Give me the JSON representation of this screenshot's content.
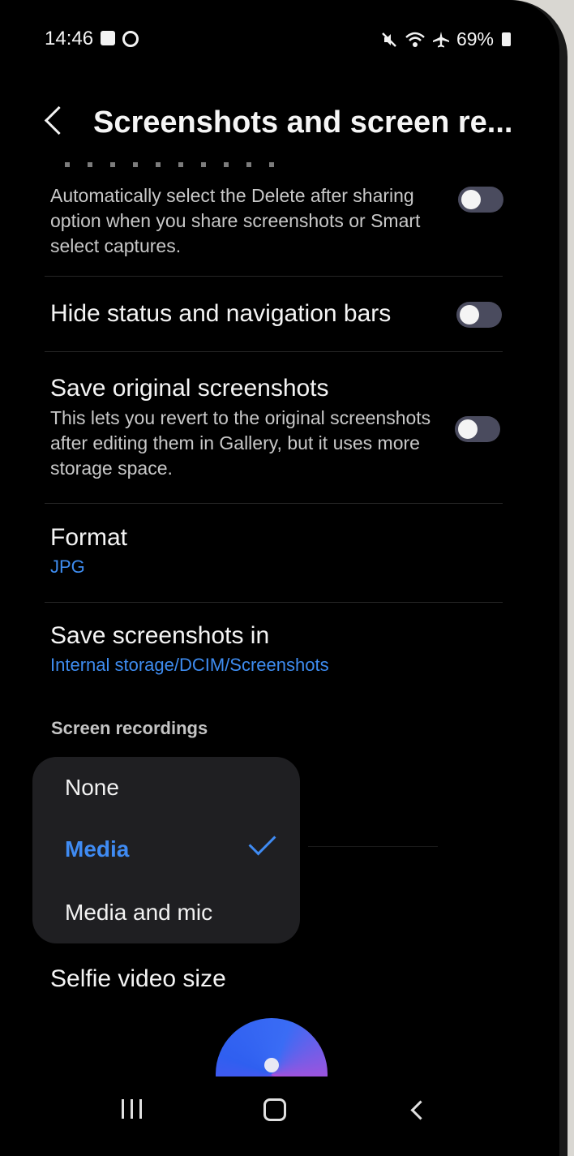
{
  "status_bar": {
    "time": "14:46",
    "battery_text": "69%",
    "icons": [
      "notification-square-icon",
      "sync-circle-icon",
      "mute-icon",
      "wifi-icon",
      "airplane-icon",
      "battery-icon"
    ]
  },
  "header": {
    "title": "Screenshots and screen re..."
  },
  "settings": {
    "delete_after_sharing": {
      "desc": "Automatically select the Delete after sharing option when you share screenshots or Smart select captures.",
      "enabled": false
    },
    "hide_bars": {
      "title": "Hide status and navigation bars",
      "enabled": false
    },
    "save_original": {
      "title": "Save original screenshots",
      "desc": "This lets you revert to the original screenshots after editing them in Gallery, but it uses more storage space.",
      "enabled": false
    },
    "format": {
      "title": "Format",
      "value": "JPG"
    },
    "save_in": {
      "title": "Save screenshots in",
      "value": "Internal storage/DCIM/Screenshots"
    }
  },
  "screen_recordings": {
    "header": "Screen recordings",
    "sound_options": [
      "None",
      "Media",
      "Media and mic"
    ],
    "selected": "Media",
    "selfie_title": "Selfie video size"
  },
  "colors": {
    "accent": "#3e8cf0",
    "background": "#000000",
    "dropdown_bg": "#1f1f22",
    "toggle_off": "#4a4b5e"
  }
}
